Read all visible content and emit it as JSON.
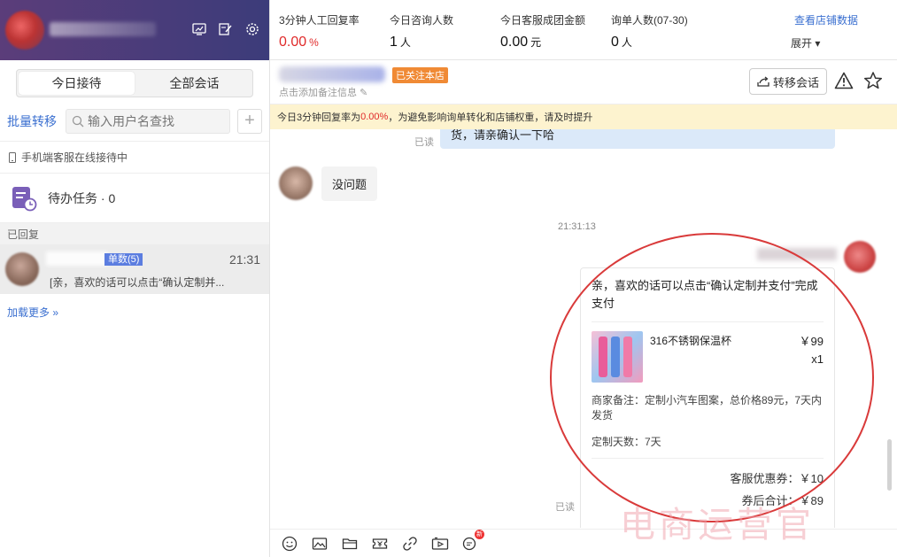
{
  "sidebar": {
    "tabs": [
      "今日接待",
      "全部会话"
    ],
    "batch_transfer": "批量转移",
    "search": {
      "placeholder": "输入用户名查找"
    },
    "mobile_status": "手机端客服在线接待中",
    "todo": "待办任务 · 0",
    "replied_label": "已回复",
    "conversation": {
      "tag": "单数(5)",
      "time": "21:31",
      "preview": "[亲，喜欢的话可以点击“确认定制并..."
    },
    "load_more": "加载更多"
  },
  "stats": {
    "items": [
      {
        "label": "3分钟人工回复率",
        "value": "0.00",
        "unit": "%"
      },
      {
        "label": "今日咨询人数",
        "value": "1",
        "unit": "人"
      },
      {
        "label": "今日客服成团金额",
        "value": "0.00",
        "unit": "元"
      },
      {
        "label": "询单人数(07-30)",
        "value": "0",
        "unit": "人"
      }
    ],
    "shop_link": "查看店铺数据",
    "expand": "展开"
  },
  "chat_header": {
    "follow_tag": "已关注本店",
    "note_link": "点击添加备注信息",
    "transfer_button": "转移会话"
  },
  "notice": {
    "prefix": "今日3分钟回复率为",
    "percent": "0.00%",
    "suffix": "，为避免影响询单转化和店铺权重，请及时提升"
  },
  "messages": {
    "read_label": "已读",
    "partial_text": "货，请亲确认一下哈",
    "customer_text": "没问题",
    "timestamp": "21:31:13",
    "card": {
      "text": "亲，喜欢的话可以点击“确认定制并支付”完成支付",
      "product_name": "316不锈钢保温杯",
      "price": "￥99",
      "qty": "x1",
      "remark": "商家备注：定制小汽车图案，总价格89元，7天内发货",
      "days": "定制天数：7天",
      "coupon": "客服优惠券：￥10",
      "total": "券后合计：￥89"
    }
  },
  "toolbar": {
    "icons": [
      "emoji-icon",
      "image-icon",
      "folder-icon",
      "coupon-icon",
      "link-icon",
      "video-icon",
      "order-icon"
    ],
    "new_badge": "新"
  },
  "watermark": "电商运营官",
  "colors": {
    "accent": "#3a6fd0",
    "alert": "#e02a2a",
    "header": "#4b3d7a",
    "notice_bg": "#fdf3cf",
    "highlight": "#d93a3a"
  }
}
